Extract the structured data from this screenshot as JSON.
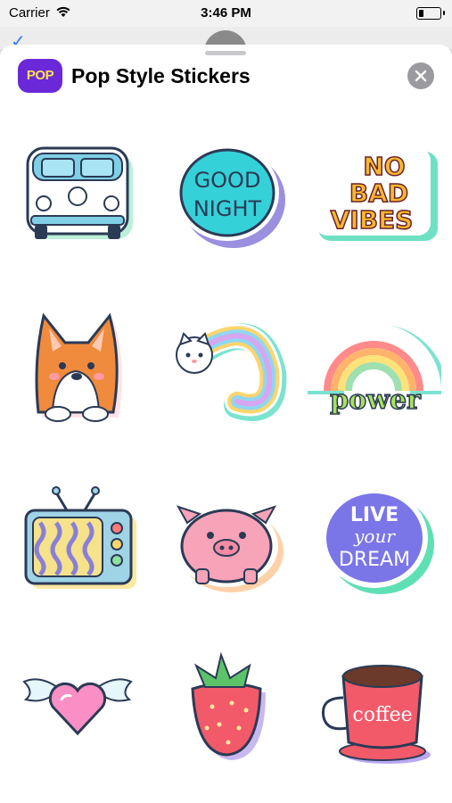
{
  "status_bar": {
    "carrier": "Carrier",
    "time": "3:46 PM"
  },
  "header": {
    "app_icon_text": "POP",
    "title": "Pop Style Stickers"
  },
  "stickers": [
    {
      "name": "van",
      "text": []
    },
    {
      "name": "good-night",
      "text": [
        "GOOD",
        "NIGHT"
      ]
    },
    {
      "name": "no-bad-vibes",
      "text": [
        "NO",
        "BAD",
        "VIBES"
      ]
    },
    {
      "name": "corgi",
      "text": []
    },
    {
      "name": "cat-rainbow",
      "text": []
    },
    {
      "name": "power-rainbow",
      "text": [
        "power"
      ]
    },
    {
      "name": "tv",
      "text": []
    },
    {
      "name": "pig",
      "text": []
    },
    {
      "name": "live-your-dream",
      "text": [
        "LIVE",
        "your",
        "DREAM"
      ]
    },
    {
      "name": "winged-heart",
      "text": []
    },
    {
      "name": "strawberry",
      "text": []
    },
    {
      "name": "coffee-cup",
      "text": [
        "coffee"
      ]
    }
  ],
  "colors": {
    "accent": "#2f7cf6",
    "app_icon_bg": "#6a28d8",
    "app_icon_text": "#ffe14d"
  }
}
